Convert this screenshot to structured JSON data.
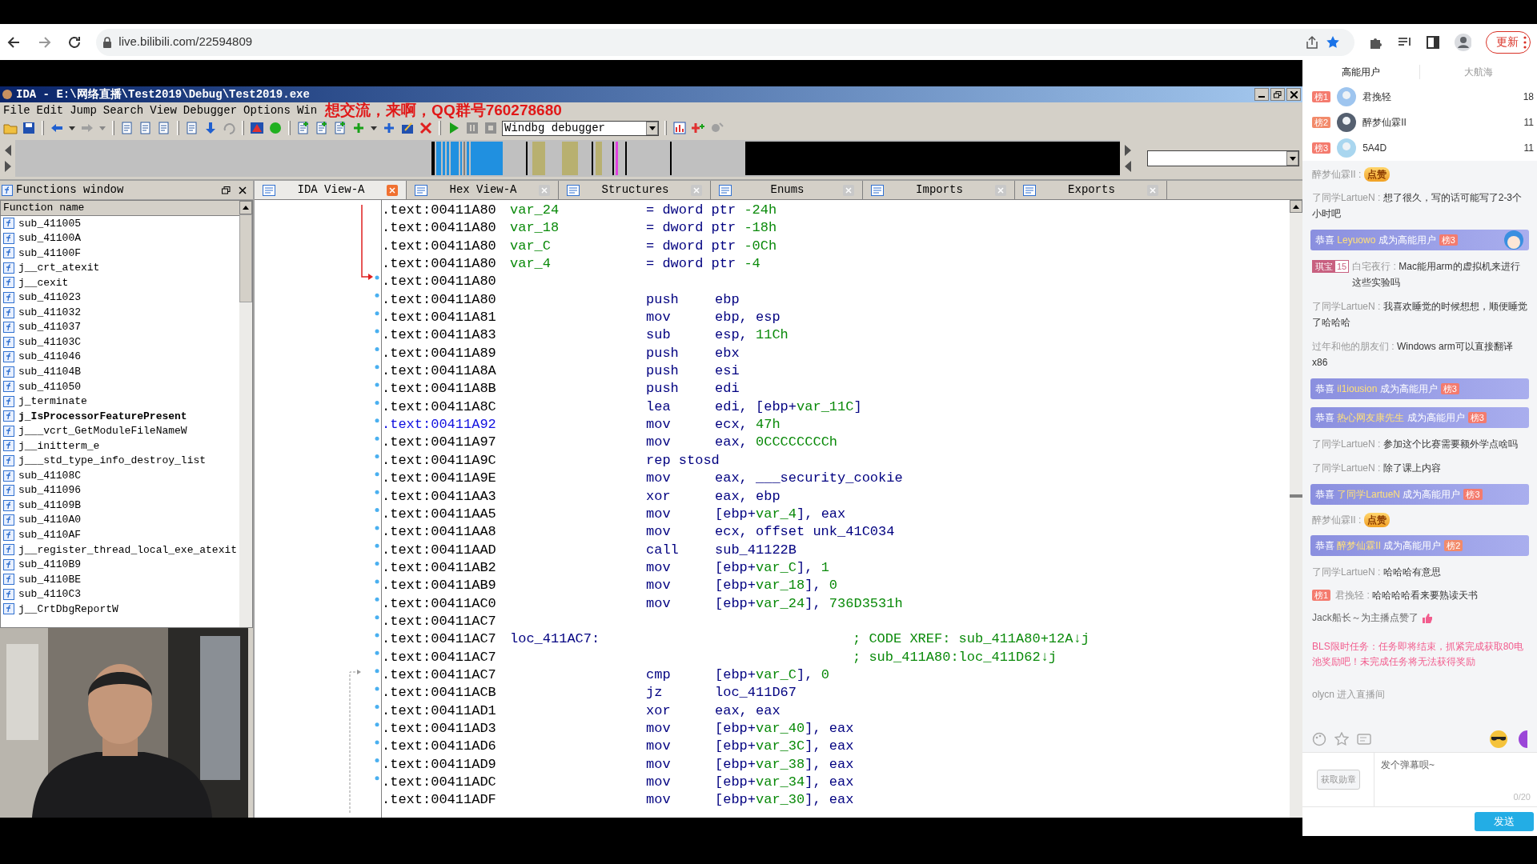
{
  "browser": {
    "url": "live.bilibili.com/22594809",
    "update_button": "更新"
  },
  "ida": {
    "title": "IDA - E:\\网络直播\\Test2019\\Debug\\Test2019.exe",
    "menu": [
      "File",
      "Edit",
      "Jump",
      "Search",
      "View",
      "Debugger",
      "Options",
      "Win"
    ],
    "overlay_caption": "想交流，来啊，QQ群号760278680",
    "debugger_select": "Windbg debugger",
    "functions_window": {
      "title": "Functions window",
      "column": "Function name",
      "items": [
        {
          "name": "sub_411005",
          "bold": false
        },
        {
          "name": "sub_41100A",
          "bold": false
        },
        {
          "name": "sub_41100F",
          "bold": false
        },
        {
          "name": "j__crt_atexit",
          "bold": false
        },
        {
          "name": "j__cexit",
          "bold": false
        },
        {
          "name": "sub_411023",
          "bold": false
        },
        {
          "name": "sub_411032",
          "bold": false
        },
        {
          "name": "sub_411037",
          "bold": false
        },
        {
          "name": "sub_41103C",
          "bold": false
        },
        {
          "name": "sub_411046",
          "bold": false
        },
        {
          "name": "sub_41104B",
          "bold": false
        },
        {
          "name": "sub_411050",
          "bold": false
        },
        {
          "name": "j_terminate",
          "bold": false
        },
        {
          "name": "j_IsProcessorFeaturePresent",
          "bold": true
        },
        {
          "name": "j___vcrt_GetModuleFileNameW",
          "bold": false
        },
        {
          "name": "j__initterm_e",
          "bold": false
        },
        {
          "name": "j___std_type_info_destroy_list",
          "bold": false
        },
        {
          "name": "sub_41108C",
          "bold": false
        },
        {
          "name": "sub_411096",
          "bold": false
        },
        {
          "name": "sub_41109B",
          "bold": false
        },
        {
          "name": "sub_4110A0",
          "bold": false
        },
        {
          "name": "sub_4110AF",
          "bold": false
        },
        {
          "name": "j__register_thread_local_exe_atexit",
          "bold": false
        },
        {
          "name": "sub_4110B9",
          "bold": false
        },
        {
          "name": "sub_4110BE",
          "bold": false
        },
        {
          "name": "sub_4110C3",
          "bold": false
        },
        {
          "name": "j__CrtDbgReportW",
          "bold": false
        }
      ]
    },
    "tabs": [
      {
        "label": "IDA View-A",
        "selected": true
      },
      {
        "label": "Hex View-A",
        "selected": false
      },
      {
        "label": "Structures",
        "selected": false
      },
      {
        "label": "Enums",
        "selected": false
      },
      {
        "label": "Imports",
        "selected": false
      },
      {
        "label": "Exports",
        "selected": false
      }
    ],
    "listing": [
      {
        "address": ".text:00411A80",
        "label": "var_24",
        "definition": "= dword ptr -24h",
        "selected": false
      },
      {
        "address": ".text:00411A80",
        "label": "var_18",
        "definition": "= dword ptr -18h",
        "selected": false
      },
      {
        "address": ".text:00411A80",
        "label": "var_C",
        "definition": "= dword ptr -0Ch",
        "selected": false
      },
      {
        "address": ".text:00411A80",
        "label": "var_4",
        "definition": "= dword ptr -4",
        "selected": false
      },
      {
        "address": ".text:00411A80",
        "selected": false
      },
      {
        "address": ".text:00411A80",
        "mnemonic": "push",
        "operands": "ebp",
        "selected": false
      },
      {
        "address": ".text:00411A81",
        "mnemonic": "mov",
        "operands": "ebp, esp",
        "selected": false
      },
      {
        "address": ".text:00411A83",
        "mnemonic": "sub",
        "operands": "esp, 11Ch",
        "selected": false
      },
      {
        "address": ".text:00411A89",
        "mnemonic": "push",
        "operands": "ebx",
        "selected": false
      },
      {
        "address": ".text:00411A8A",
        "mnemonic": "push",
        "operands": "esi",
        "selected": false
      },
      {
        "address": ".text:00411A8B",
        "mnemonic": "push",
        "operands": "edi",
        "selected": false
      },
      {
        "address": ".text:00411A8C",
        "mnemonic": "lea",
        "operands": "edi, [ebp+var_11C]",
        "selected": false
      },
      {
        "address": ".text:00411A92",
        "mnemonic": "mov",
        "operands": "ecx, 47h",
        "selected": true
      },
      {
        "address": ".text:00411A97",
        "mnemonic": "mov",
        "operands": "eax, 0CCCCCCCCh",
        "selected": false
      },
      {
        "address": ".text:00411A9C",
        "mnemonic": "rep stosd",
        "selected": false
      },
      {
        "address": ".text:00411A9E",
        "mnemonic": "mov",
        "operands": "eax, ___security_cookie",
        "selected": false
      },
      {
        "address": ".text:00411AA3",
        "mnemonic": "xor",
        "operands": "eax, ebp",
        "selected": false
      },
      {
        "address": ".text:00411AA5",
        "mnemonic": "mov",
        "operands": "[ebp+var_4], eax",
        "selected": false
      },
      {
        "address": ".text:00411AA8",
        "mnemonic": "mov",
        "operands": "ecx, offset unk_41C034",
        "selected": false
      },
      {
        "address": ".text:00411AAD",
        "mnemonic": "call",
        "operands": "sub_41122B",
        "selected": false
      },
      {
        "address": ".text:00411AB2",
        "mnemonic": "mov",
        "operands": "[ebp+var_C], 1",
        "selected": false
      },
      {
        "address": ".text:00411AB9",
        "mnemonic": "mov",
        "operands": "[ebp+var_18], 0",
        "selected": false
      },
      {
        "address": ".text:00411AC0",
        "mnemonic": "mov",
        "operands": "[ebp+var_24], 736D3531h",
        "selected": false
      },
      {
        "address": ".text:00411AC7",
        "selected": false
      },
      {
        "address": ".text:00411AC7",
        "label": "loc_411AC7:",
        "comment": "; CODE XREF: sub_411A80+12A↓j",
        "selected": false
      },
      {
        "address": ".text:00411AC7",
        "comment": "; sub_411A80:loc_411D62↓j",
        "selected": false
      },
      {
        "address": ".text:00411AC7",
        "mnemonic": "cmp",
        "operands": "[ebp+var_C], 0",
        "selected": false
      },
      {
        "address": ".text:00411ACB",
        "mnemonic": "jz",
        "operands": "loc_411D67",
        "selected": false
      },
      {
        "address": ".text:00411AD1",
        "mnemonic": "xor",
        "operands": "eax, eax",
        "selected": false
      },
      {
        "address": ".text:00411AD3",
        "mnemonic": "mov",
        "operands": "[ebp+var_40], eax",
        "selected": false
      },
      {
        "address": ".text:00411AD6",
        "mnemonic": "mov",
        "operands": "[ebp+var_3C], eax",
        "selected": false
      },
      {
        "address": ".text:00411AD9",
        "mnemonic": "mov",
        "operands": "[ebp+var_38], eax",
        "selected": false
      },
      {
        "address": ".text:00411ADC",
        "mnemonic": "mov",
        "operands": "[ebp+var_34], eax",
        "selected": false
      },
      {
        "address": ".text:00411ADF",
        "mnemonic": "mov",
        "operands": "[ebp+var_30], eax",
        "selected": false
      }
    ]
  },
  "chat": {
    "tabs": [
      {
        "label": "高能用户",
        "selected": true
      },
      {
        "label": "大航海",
        "selected": false
      }
    ],
    "ranking": [
      {
        "rank": "榜1",
        "name": "君挽轻",
        "score": "18"
      },
      {
        "rank": "榜2",
        "name": "醉梦仙霖II",
        "score": "11"
      },
      {
        "rank": "榜3",
        "name": "5A4D",
        "score": "11"
      }
    ],
    "messages": [
      {
        "kind": "gift",
        "user": "醉梦仙霖II :",
        "gift": "点赞"
      },
      {
        "kind": "text",
        "user": "了同学LartueN :",
        "text": "想了很久，写的话可能写了2-3个小时吧"
      },
      {
        "kind": "congrats",
        "prefix": "恭喜",
        "user": "Leyuowo",
        "suffix": "成为高能用户",
        "rank": "榜3"
      },
      {
        "kind": "medal",
        "medal": "琪宝",
        "medal_level": "15",
        "user": "白宅夜行 :",
        "text": "Mac能用arm的虚拟机来进行这些实验吗"
      },
      {
        "kind": "text",
        "user": "了同学LartueN :",
        "text": "我喜欢睡觉的时候想想，顺便睡觉了哈哈哈"
      },
      {
        "kind": "text",
        "user": "过年和他的朋友们 :",
        "text": "Windows arm可以直接翻译x86"
      },
      {
        "kind": "congrats",
        "prefix": "恭喜",
        "user": "il1iousion",
        "suffix": "成为高能用户",
        "rank": "榜3"
      },
      {
        "kind": "congrats",
        "prefix": "恭喜",
        "user": "热心网友康先生",
        "suffix": "成为高能用户",
        "rank": "榜3"
      },
      {
        "kind": "text",
        "user": "了同学LartueN :",
        "text": "参加这个比赛需要额外学点啥吗"
      },
      {
        "kind": "text",
        "user": "了同学LartueN :",
        "text": "除了课上内容"
      },
      {
        "kind": "congrats",
        "prefix": "恭喜",
        "user": "了同学LartueN",
        "suffix": "成为高能用户",
        "rank": "榜3"
      },
      {
        "kind": "gift",
        "user": "醉梦仙霖II :",
        "gift": "点赞"
      },
      {
        "kind": "congrats",
        "prefix": "恭喜",
        "user": "醉梦仙霖II",
        "suffix": "成为高能用户",
        "rank": "榜2"
      },
      {
        "kind": "text",
        "user": "了同学LartueN :",
        "text": "哈哈哈有意思"
      },
      {
        "kind": "ranked",
        "rank": "榜1",
        "user": "君挽轻 :",
        "text": "哈哈哈哈看来要熟读天书"
      },
      {
        "kind": "like",
        "user": "Jack船长",
        "text": "～为主播点赞了"
      },
      {
        "kind": "system",
        "text": "BLS限时任务：任务即将结束，抓紧完成获取80电池奖励吧！未完成任务将无法获得奖励"
      },
      {
        "kind": "enter",
        "user": "olycn",
        "text": "进入直播间"
      }
    ],
    "medal_button": "获取勋章",
    "input": {
      "placeholder": "发个弹幕呗~",
      "counter": "0/20"
    },
    "send_button": "发送"
  }
}
